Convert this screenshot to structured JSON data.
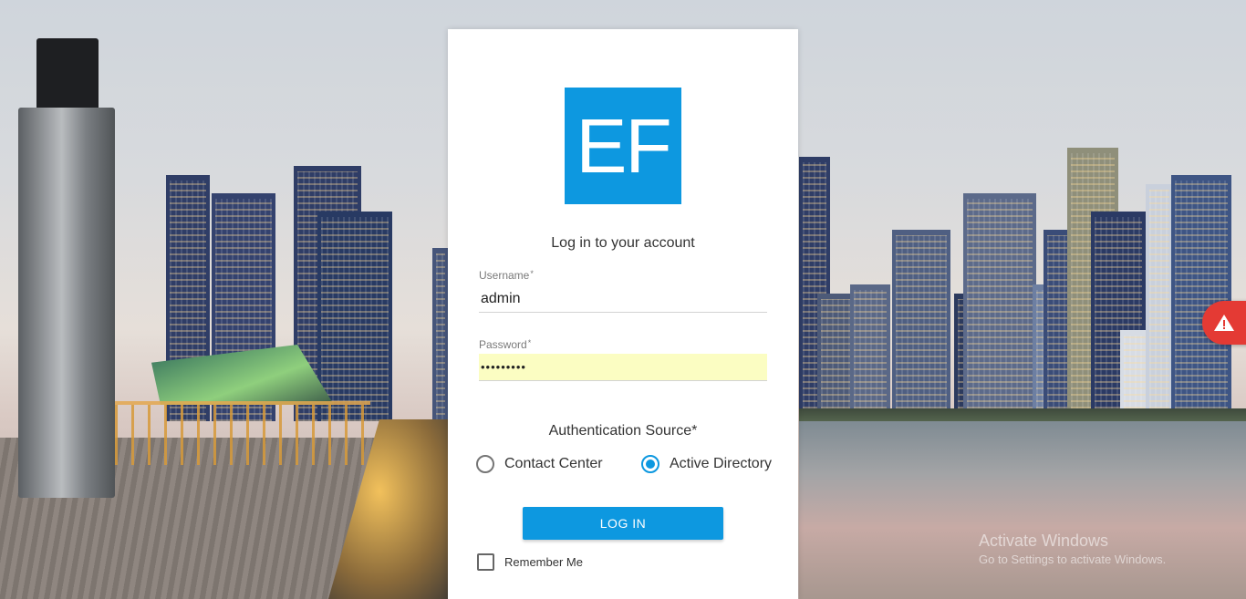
{
  "logo": {
    "text": "EF",
    "color": "#0d98e0"
  },
  "login": {
    "title": "Log in to your account",
    "username": {
      "label": "Username",
      "required_mark": "*",
      "value": "admin"
    },
    "password": {
      "label": "Password",
      "required_mark": "*",
      "value": "•••••••••"
    },
    "auth_source": {
      "label": "Authentication Source*",
      "options": [
        {
          "label": "Contact Center",
          "selected": false
        },
        {
          "label": "Active Directory",
          "selected": true
        }
      ]
    },
    "submit_label": "LOG IN",
    "remember_me": {
      "label": "Remember Me",
      "checked": false
    }
  },
  "watermark": {
    "title": "Activate Windows",
    "subtitle": "Go to Settings to activate Windows."
  },
  "colors": {
    "accent": "#0d98e0",
    "alert": "#e43a34",
    "autofill": "#fbfdc2"
  },
  "icons": {
    "alert": "warning-triangle-icon"
  }
}
